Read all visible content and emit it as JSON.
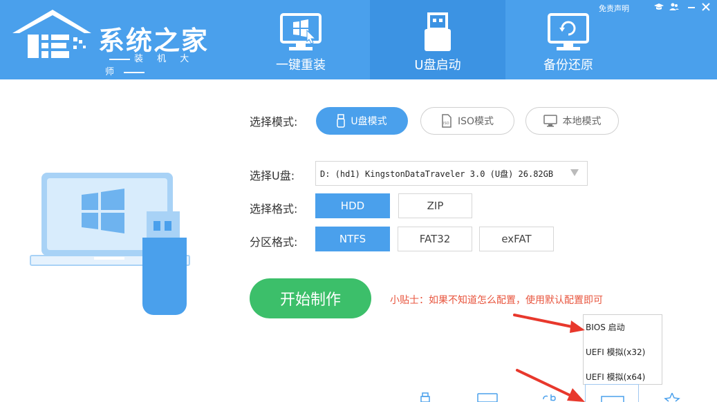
{
  "header": {
    "logo_title": "系统之家",
    "logo_subtitle": "装 机 大 师",
    "disclaimer_link": "免责声明",
    "tabs": [
      {
        "label": "一键重装",
        "icon": "monitor-windows-icon"
      },
      {
        "label": "U盘启动",
        "icon": "usb-drive-icon"
      },
      {
        "label": "备份还原",
        "icon": "monitor-restore-icon"
      }
    ],
    "window_controls": [
      "graduate-cap-icon",
      "users-icon",
      "minimize-icon",
      "close-icon"
    ]
  },
  "form": {
    "mode_label": "选择模式:",
    "modes": [
      {
        "label": "U盘模式",
        "icon": "usb-icon",
        "selected": true
      },
      {
        "label": "ISO模式",
        "icon": "iso-file-icon",
        "selected": false
      },
      {
        "label": "本地模式",
        "icon": "monitor-icon",
        "selected": false
      }
    ],
    "disk_label": "选择U盘:",
    "disk_value": "D: (hd1) KingstonDataTraveler 3.0 (U盘) 26.82GB",
    "format_label": "选择格式:",
    "formats": [
      {
        "label": "HDD",
        "selected": true
      },
      {
        "label": "ZIP",
        "selected": false
      }
    ],
    "partition_label": "分区格式:",
    "partitions": [
      {
        "label": "NTFS",
        "selected": true
      },
      {
        "label": "FAT32",
        "selected": false
      },
      {
        "label": "exFAT",
        "selected": false
      }
    ],
    "start_button": "开始制作",
    "tip": "小贴士：如果不知道怎么配置，使用默认配置即可"
  },
  "popup_menu": {
    "items": [
      "BIOS 启动",
      "UEFI 模拟(x32)",
      "UEFI 模拟(x64)"
    ]
  },
  "colors": {
    "header_blue": "#4aa0ec",
    "active_blue": "#4aa0ec",
    "start_green": "#3cbf6a",
    "tip_red": "#e8553e",
    "arrow_red": "#e8382c"
  }
}
